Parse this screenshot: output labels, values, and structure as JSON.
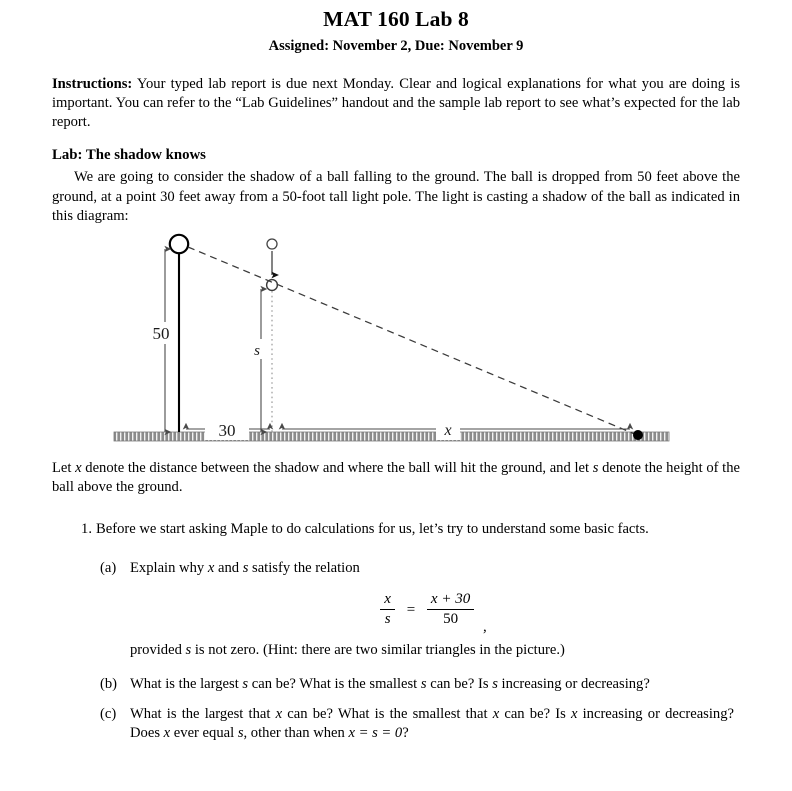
{
  "document": {
    "title": "MAT 160 Lab 8",
    "subtitle": "Assigned: November 2, Due: November 9",
    "instructions": {
      "lead": "Instructions:",
      "text": " Your typed lab report is due next Monday. Clear and logical explanations for what you are doing is important. You can refer to the “Lab Guidelines” handout and the sample lab report to see what’s expected for the lab report."
    },
    "lab_heading": "Lab: The shadow knows",
    "lab_intro": "We are going to consider the shadow of a ball falling to the ground. The ball is dropped from 50 feet above the ground, at a point 30 feet away from a 50-foot tall light pole. The light is casting a shadow of the ball as indicated in this diagram:",
    "after_figure": {
      "part1": "Let ",
      "var_x": "x",
      "part2": " denote the distance between the shadow and where the ball will hit the ground, and let ",
      "var_s": "s",
      "part3": " denote the height of the ball above the ground."
    },
    "items": [
      {
        "marker": "1.",
        "text": "Before we start asking Maple to do calculations for us, let’s try to understand some basic facts."
      }
    ],
    "subitems": [
      {
        "marker": "(a)",
        "text_before": "Explain why ",
        "var_x": "x",
        "text_mid": " and ",
        "var_s": "s",
        "text_after": " satisfy the relation",
        "equation": {
          "left_num": "x",
          "left_den": "s",
          "sign": "=",
          "right_num": "x + 30",
          "right_den": "50",
          "trailing": ","
        },
        "provided_before": "provided ",
        "provided_var": "s",
        "provided_after": " is not zero. (Hint: there are two similar triangles in the picture.)"
      },
      {
        "marker": "(b)",
        "seg": [
          "What is the largest ",
          "s",
          " can be? What is the smallest ",
          "s",
          " can be? Is ",
          "s",
          " increasing or decreasing?"
        ]
      },
      {
        "marker": "(c)",
        "seg": [
          "What is the largest that ",
          "x",
          " can be? What is the smallest that ",
          "x",
          " can be? Is ",
          "x",
          " increasing or decreasing? Does ",
          "x",
          " ever equal ",
          "s",
          ", other than when ",
          "x = s = 0",
          "?"
        ]
      }
    ]
  },
  "figure": {
    "name": "shadow-diagram",
    "labels": {
      "pole_height": "50",
      "ball_height": "s",
      "ground_distance_pole_to_ball": "30",
      "ground_distance_ball_to_shadow": "x"
    },
    "colors": {
      "ink": "#000000",
      "ground": "#808080",
      "guide": "#555555"
    },
    "elements": [
      "light-source-circle",
      "light-pole",
      "ball-start-circle",
      "ball-current-circle",
      "ball-fall-arrow",
      "light-ray-dashed",
      "shadow-dot",
      "ground-band",
      "height-50-arrow",
      "height-s-arrow",
      "distance-30-arrow",
      "distance-x-arrow"
    ]
  }
}
